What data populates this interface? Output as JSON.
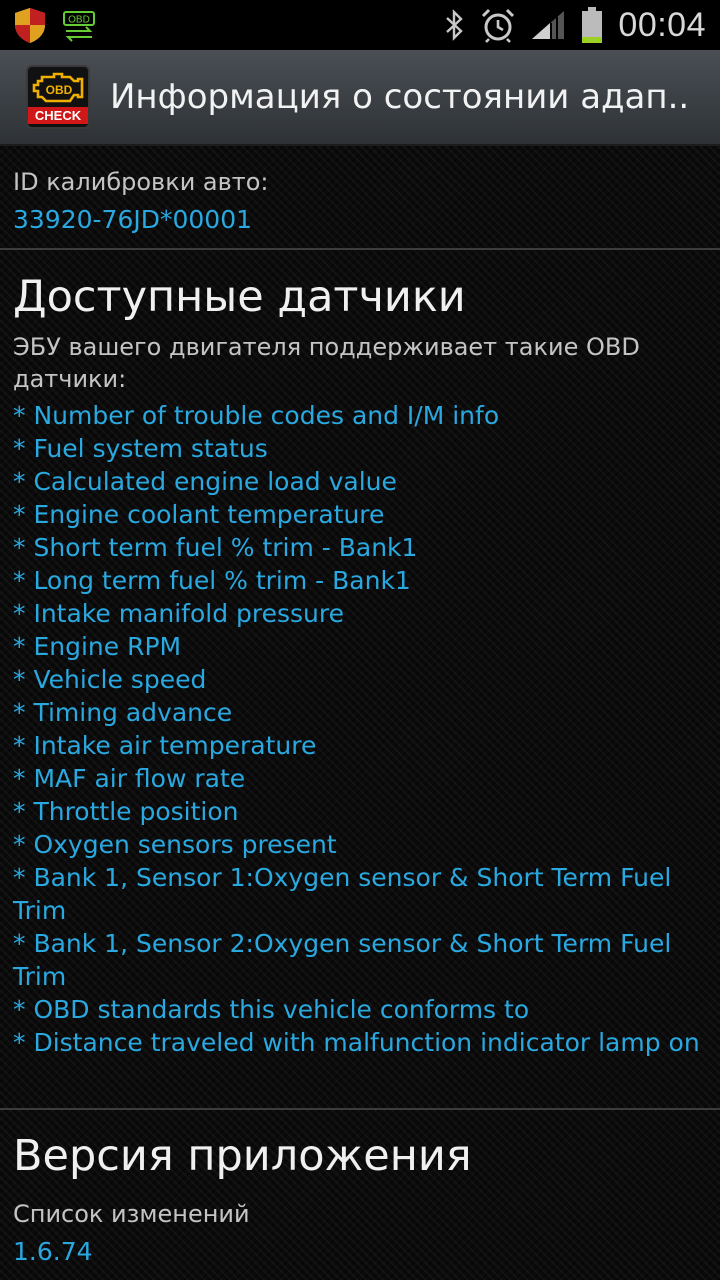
{
  "status_bar": {
    "time": "00:04",
    "icons": [
      "shield-icon",
      "obd-transfer-icon",
      "bluetooth-icon",
      "alarm-icon",
      "signal-icon",
      "battery-icon"
    ],
    "obd_label": "OBD"
  },
  "action_bar": {
    "app_icon_top": "OBD",
    "app_icon_bottom": "CHECK",
    "title": "Информация о состоянии адап.."
  },
  "calibration": {
    "label": "ID калибровки авто:",
    "value": "33920-76JD*00001"
  },
  "sensors": {
    "heading": "Доступные датчики",
    "intro": "ЭБУ вашего двигателя поддерживает такие OBD датчики:",
    "items": [
      "* Number of trouble codes and I/M info",
      "* Fuel system status",
      "* Calculated engine load value",
      "* Engine coolant temperature",
      "* Short term fuel % trim - Bank1",
      "* Long term fuel % trim - Bank1",
      "* Intake manifold pressure",
      "* Engine RPM",
      "* Vehicle speed",
      "* Timing advance",
      "* Intake air temperature",
      "* MAF air flow rate",
      "* Throttle position",
      "* Oxygen sensors present",
      "* Bank 1, Sensor 1:Oxygen sensor & Short Term Fuel Trim",
      "* Bank 1, Sensor 2:Oxygen sensor & Short Term Fuel Trim",
      "* OBD standards this vehicle conforms to",
      "* Distance traveled with malfunction indicator lamp on"
    ]
  },
  "app_version": {
    "heading": "Версия приложения",
    "changelog_label": "Список изменений",
    "version": "1.6.74"
  },
  "colors": {
    "accent": "#2aa8e0",
    "heading": "#f0f0f0",
    "label": "#c4c4c4",
    "battery_level": "#9bd127"
  }
}
